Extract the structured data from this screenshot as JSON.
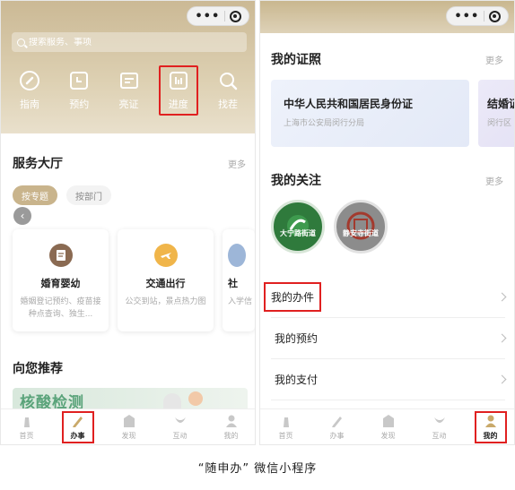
{
  "left_screen": {
    "search": {
      "placeholder": "搜索服务、事项"
    },
    "quick_actions": [
      {
        "label": "指南",
        "icon": "compass-icon"
      },
      {
        "label": "预约",
        "icon": "calendar-icon"
      },
      {
        "label": "亮证",
        "icon": "card-icon"
      },
      {
        "label": "进度",
        "icon": "progress-bars-icon"
      },
      {
        "label": "找茬",
        "icon": "search-icon"
      }
    ],
    "service_hall": {
      "title": "服务大厅",
      "more": "更多",
      "chips": [
        "按专题",
        "按部门"
      ],
      "cards": [
        {
          "title": "婚育婴幼",
          "desc": "婚姻登记预约、疫苗接种点查询、独生...",
          "icon": "document-icon",
          "color": "#8a6a52"
        },
        {
          "title": "交通出行",
          "desc": "公交到站，景点热力图",
          "icon": "plane-icon",
          "color": "#f0b54a"
        },
        {
          "title": "社",
          "desc": "入学信 示范幕",
          "icon": "",
          "color": "#9db6d8"
        }
      ]
    },
    "recommend": {
      "title": "向您推荐",
      "banner_text": "核酸检测"
    }
  },
  "tabbar_left": [
    {
      "label": "首页",
      "icon": "home-icon"
    },
    {
      "label": "办事",
      "icon": "pen-icon"
    },
    {
      "label": "发现",
      "icon": "building-icon"
    },
    {
      "label": "互动",
      "icon": "hands-icon"
    },
    {
      "label": "我的",
      "icon": "user-icon"
    }
  ],
  "right_screen": {
    "certificates": {
      "title": "我的证照",
      "more": "更多",
      "items": [
        {
          "title": "中华人民共和国居民身份证",
          "sub": "上海市公安局闵行分局"
        },
        {
          "title": "结婚证",
          "sub": "闵行区"
        }
      ]
    },
    "follows": {
      "title": "我的关注",
      "more": "更多",
      "items": [
        {
          "label": "大宁路街道",
          "color": "#2f7a3c"
        },
        {
          "label": "静安寺街道",
          "color": "#8c8c8c"
        }
      ]
    },
    "menu": [
      {
        "label": "我的办件"
      },
      {
        "label": "我的预约"
      },
      {
        "label": "我的支付"
      }
    ]
  },
  "tabbar_right": [
    {
      "label": "首页",
      "icon": "home-icon"
    },
    {
      "label": "办事",
      "icon": "pen-icon"
    },
    {
      "label": "发现",
      "icon": "building-icon"
    },
    {
      "label": "互动",
      "icon": "hands-icon"
    },
    {
      "label": "我的",
      "icon": "user-icon"
    }
  ],
  "caption": "“随申办” 微信小程序",
  "colors": {
    "gold": "#c9b48c",
    "highlight": "#e02020"
  }
}
